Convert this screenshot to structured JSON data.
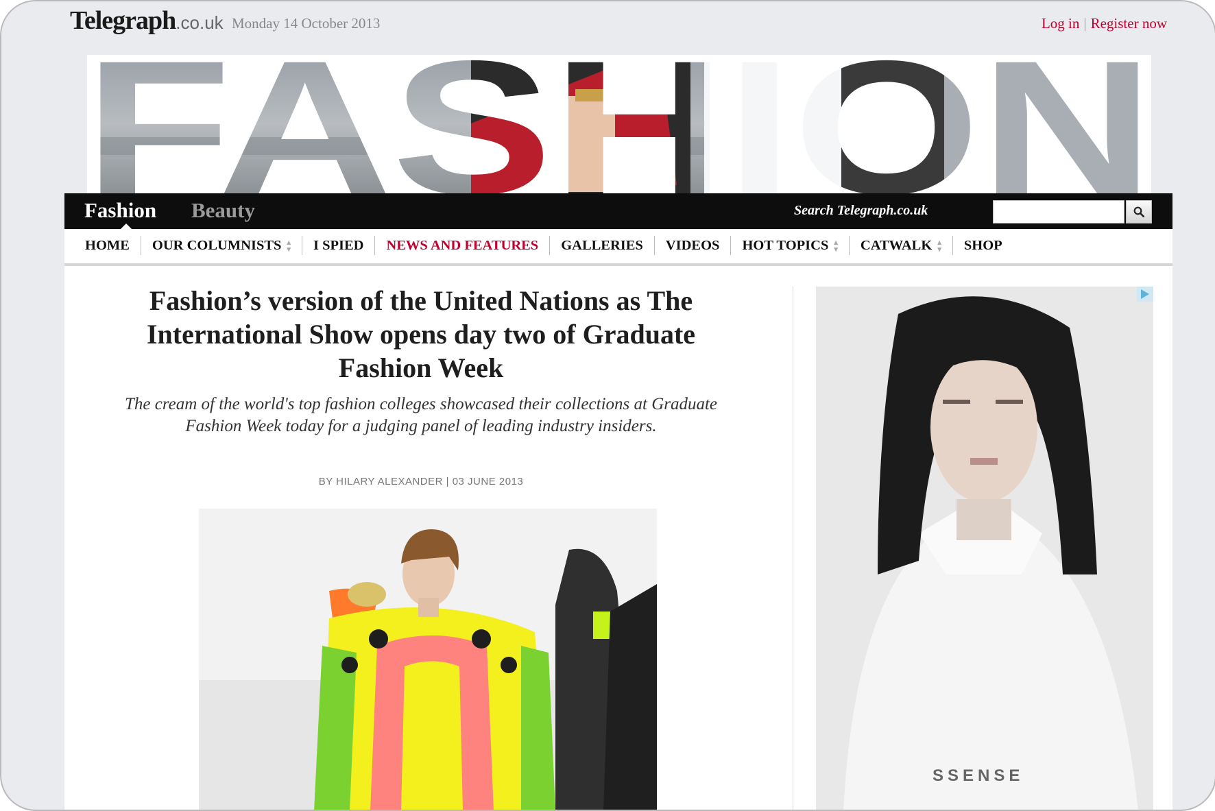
{
  "header": {
    "logo_main": "Telegraph",
    "logo_domain": ".co.uk",
    "date": "Monday 14 October 2013",
    "login": "Log in",
    "register": "Register now"
  },
  "banner": {
    "title": "FASHION"
  },
  "section_bar": {
    "fashion": "Fashion",
    "beauty": "Beauty",
    "search_label": "Search Telegraph.co.uk",
    "search_value": ""
  },
  "nav": {
    "items": [
      {
        "label": "HOME",
        "dropdown": false
      },
      {
        "label": "OUR COLUMNISTS",
        "dropdown": true
      },
      {
        "label": "I SPIED",
        "dropdown": false
      },
      {
        "label": "NEWS AND FEATURES",
        "dropdown": false,
        "active": true
      },
      {
        "label": "GALLERIES",
        "dropdown": false
      },
      {
        "label": "VIDEOS",
        "dropdown": false
      },
      {
        "label": "HOT TOPICS",
        "dropdown": true
      },
      {
        "label": "CATWALK",
        "dropdown": true
      },
      {
        "label": "SHOP",
        "dropdown": false
      }
    ]
  },
  "article": {
    "headline": "Fashion’s version of the United Nations as The International Show opens day two of Graduate Fashion Week",
    "standfirst": "The cream of the world's top fashion colleges showcased their collections at Graduate Fashion Week today for a judging panel of leading industry insiders.",
    "byline": "BY HILARY ALEXANDER | 03 JUNE 2013"
  },
  "advert": {
    "brand": "SSENSE"
  },
  "colors": {
    "accent": "#c2002f",
    "bar": "#0d0d0d",
    "nav_text": "#111111"
  }
}
